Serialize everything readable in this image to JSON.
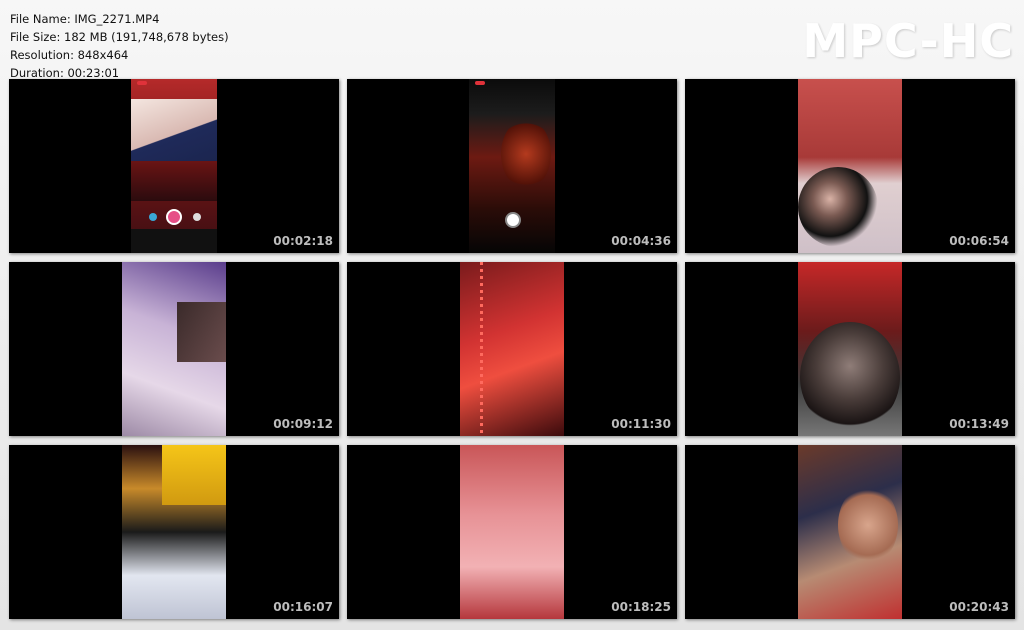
{
  "file_info": {
    "file_name": "File Name: IMG_2271.MP4",
    "file_size": "File Size: 182 MB (191,748,678 bytes)",
    "resolution": "Resolution: 848x464",
    "duration": "Duration: 00:23:01"
  },
  "logo": "MPC-HC",
  "thumbnails": [
    {
      "timestamp": "00:02:18"
    },
    {
      "timestamp": "00:04:36"
    },
    {
      "timestamp": "00:06:54"
    },
    {
      "timestamp": "00:09:12"
    },
    {
      "timestamp": "00:11:30"
    },
    {
      "timestamp": "00:13:49"
    },
    {
      "timestamp": "00:16:07"
    },
    {
      "timestamp": "00:18:25"
    },
    {
      "timestamp": "00:20:43"
    }
  ],
  "colors": {
    "thumb_background": "#000000",
    "timestamp_text": "#bdbdbd",
    "logo_text": "#ffffff"
  }
}
